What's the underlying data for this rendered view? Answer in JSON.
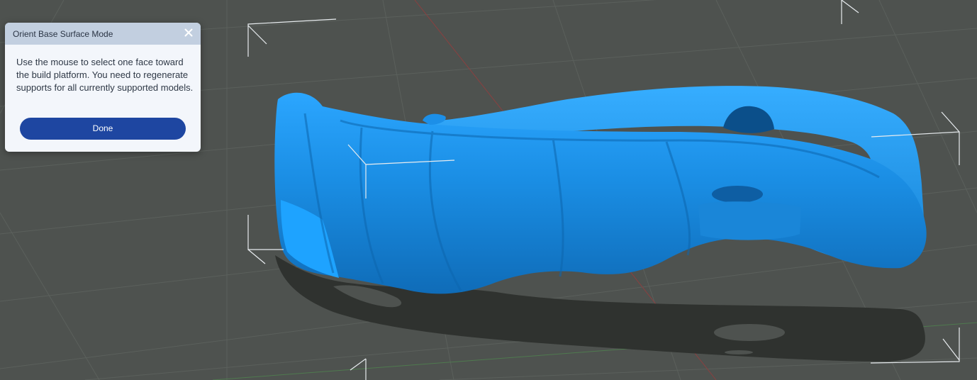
{
  "dialog": {
    "title": "Orient Base Surface Mode",
    "message": "Use the mouse to select one face toward the build platform. You need to regenerate supports for all currently supported models.",
    "done_label": "Done"
  },
  "icons": {
    "close": "close-icon"
  },
  "colors": {
    "background": "#4e524f",
    "model": "#1e8fe6",
    "dialog_header": "#c2cfe0",
    "done_button": "#1e46a1"
  }
}
